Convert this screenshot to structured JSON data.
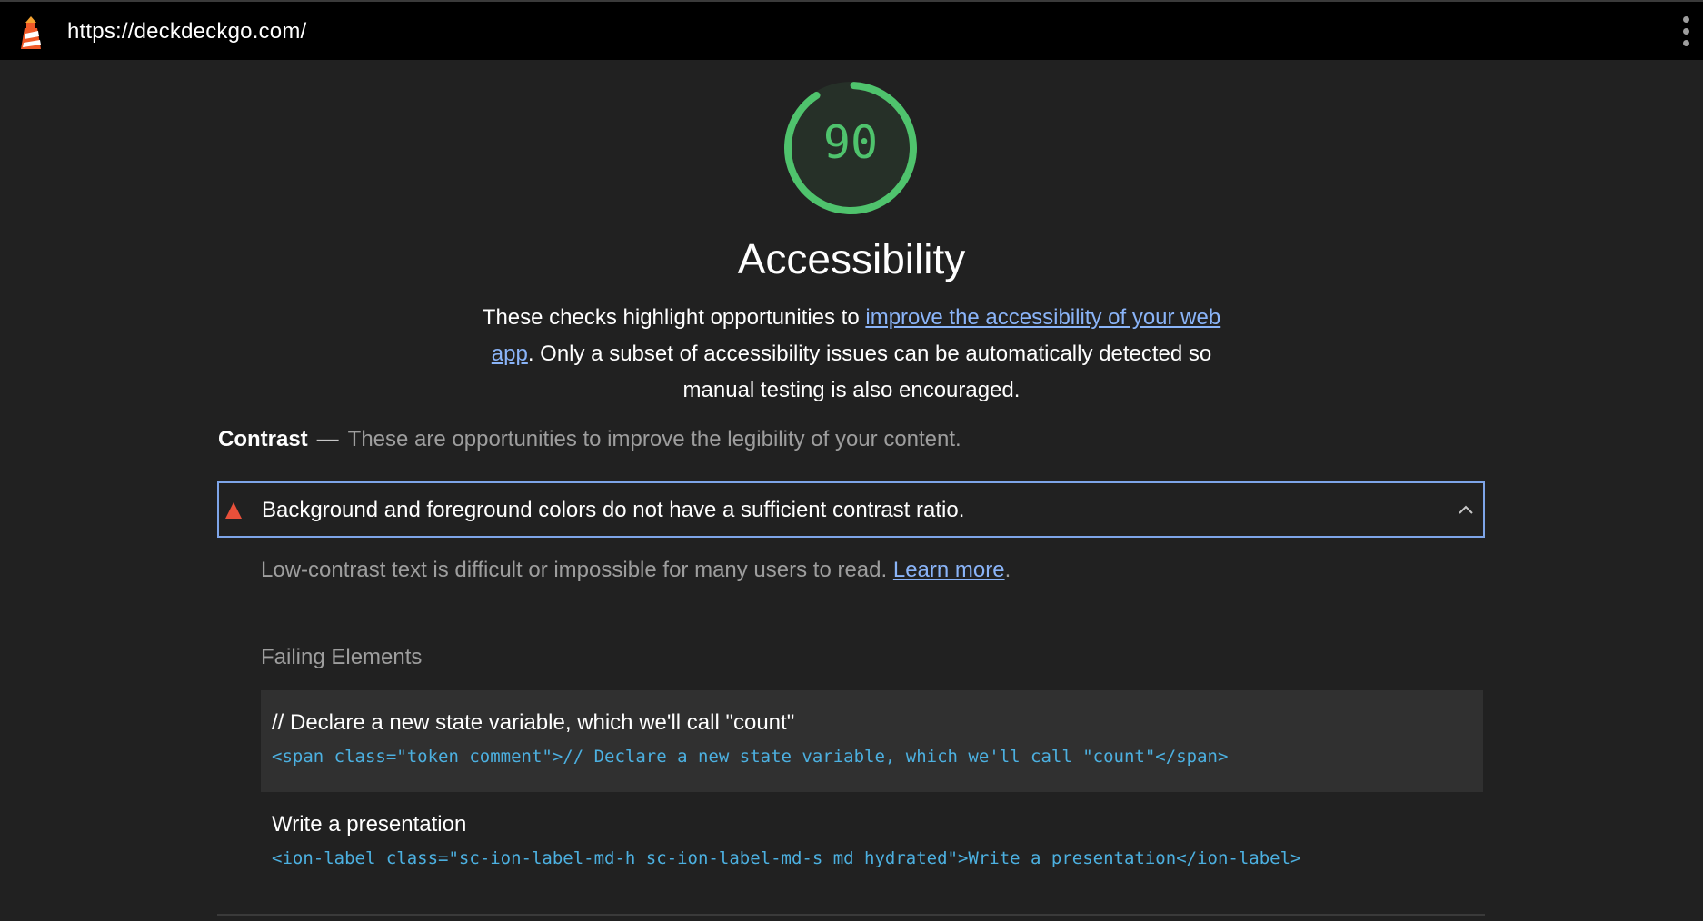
{
  "browser": {
    "url": "https://deckdeckgo.com/",
    "logo_icon": "lighthouse-icon",
    "menu_icon": "kebab-menu-icon"
  },
  "score": {
    "value": 90,
    "fraction": 0.9,
    "color": "#4fc36d",
    "track_color": "#263028"
  },
  "category": {
    "title": "Accessibility",
    "description_before": "These checks highlight opportunities to ",
    "description_link": "improve the accessibility of your web app",
    "description_after": ". Only a subset of accessibility issues can be automatically detected so manual testing is also encouraged."
  },
  "group": {
    "title": "Contrast",
    "dash": "—",
    "description": "These are opportunities to improve the legibility of your content."
  },
  "audit": {
    "status_icon": "fail-triangle-icon",
    "status_color": "#e8503a",
    "title": "Background and foreground colors do not have a sufficient contrast ratio.",
    "expanded_icon": "chevron-up-icon",
    "description": "Low-contrast text is difficult or impossible for many users to read. ",
    "learn_more": "Learn more",
    "period": "."
  },
  "failing": {
    "title": "Failing Elements",
    "nodes": [
      {
        "label": "// Declare a new state variable, which we'll call \"count\"",
        "snippet": "<span class=\"token comment\">// Declare a new state variable, which we'll call \"count\"</span>"
      },
      {
        "label": "Write a presentation",
        "snippet": "<ion-label class=\"sc-ion-label-md-h sc-ion-label-md-s md hydrated\">Write a presentation</ion-label>"
      }
    ]
  }
}
